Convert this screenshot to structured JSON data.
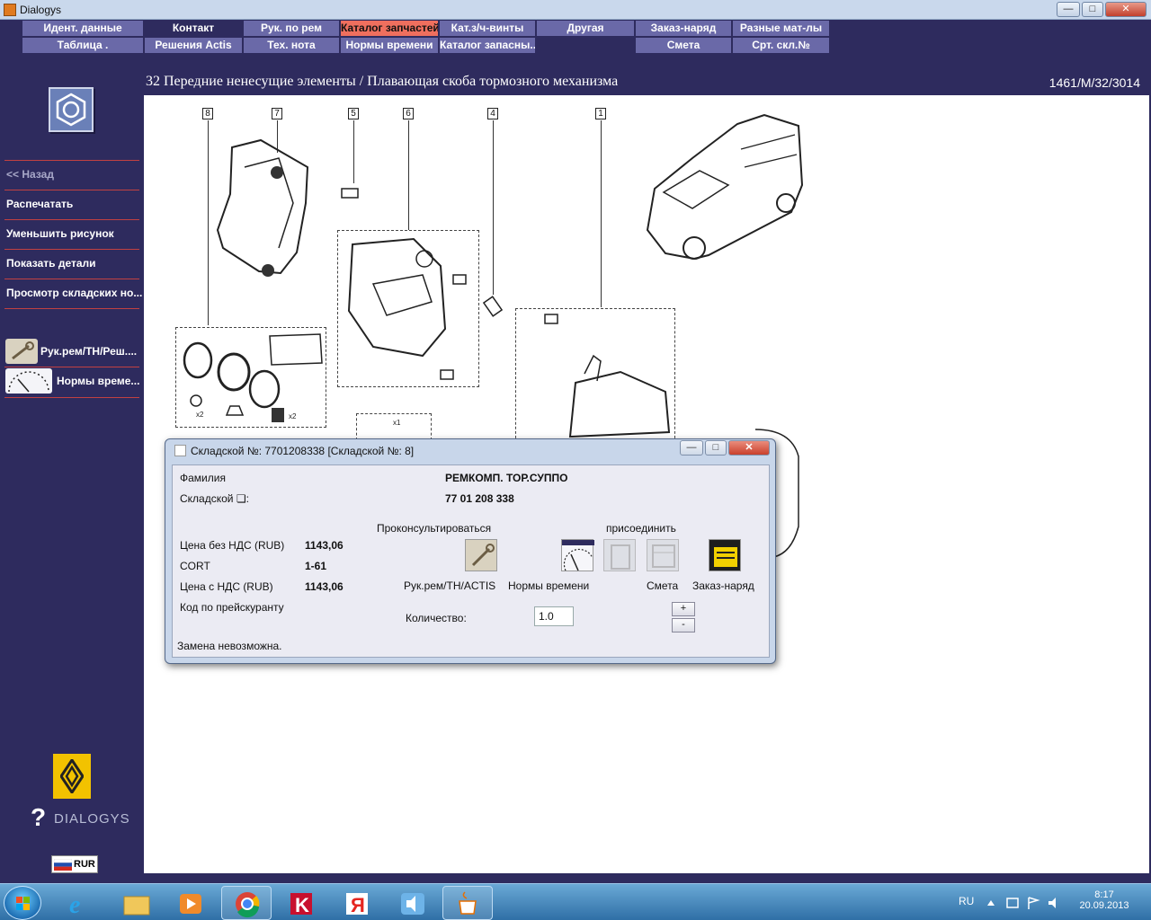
{
  "window": {
    "title": "Dialogys",
    "controls": [
      "—",
      "□",
      "✕"
    ]
  },
  "menu": {
    "row1": [
      "Идент. данные",
      "Контакт",
      "Рук. по рем",
      "Каталог запчастей",
      "Кат.з/ч-винты",
      "Другая",
      "Заказ-наряд",
      "Разные мат-лы"
    ],
    "row2": [
      "Таблица .",
      "Решения Actis",
      "Тех. нота",
      "Нормы времени",
      "Каталог запасны...",
      "Смета",
      "Срт. скл.№"
    ],
    "active": "Каталог запчастей"
  },
  "header": {
    "title": "32 Передние ненесущие элементы / Плавающая скоба тормозного механизма",
    "code": "1461/M/32/3014"
  },
  "sidebar": {
    "back": "<< Назад",
    "items": [
      "Распечатать",
      "Уменьшить рисунок",
      "Показать детали",
      "Просмотр складских но..."
    ],
    "tools": [
      "Рук.рем/TH/Реш....",
      "Нормы време..."
    ],
    "brand": "DIALOGYS",
    "currency": "RUR"
  },
  "drawing": {
    "callouts": [
      "8",
      "7",
      "5",
      "6",
      "4",
      "1"
    ],
    "quantities": [
      "x2",
      "x2",
      "x1"
    ]
  },
  "dialog": {
    "title": "Складской №: 7701208338 [Складской №: 8]",
    "family_label": "Фамилия",
    "family_value": "РЕМКОМП. ТОР.СУППО",
    "part_label": "Складской ❏:",
    "part_value": "77 01 208 338",
    "consult_heading": "Проконсультироваться",
    "attach_heading": "присоединить",
    "price_net_label": "Цена без НДС (RUB)",
    "price_net_value": "1143,06",
    "cort_label": "CORT",
    "cort_value": "1-61",
    "price_vat_label": "Цена с НДС (RUB)",
    "price_vat_value": "1143,06",
    "pricelist_label": "Код по прейскуранту",
    "tool_labels": [
      "Рук.рем/TH/ACTIS",
      "Нормы времени",
      "Смета",
      "Заказ-наряд"
    ],
    "qty_label": "Количество:",
    "qty_value": "1.0",
    "plus": "+",
    "minus": "-",
    "status": "Замена невозможна."
  },
  "taskbar": {
    "lang": "RU",
    "time": "8:17",
    "date": "20.09.2013"
  },
  "colors": {
    "background": "#2e2b5e",
    "menu_light": "#6a69a8",
    "menu_active": "#ef6f5e",
    "separator": "#c24141"
  }
}
